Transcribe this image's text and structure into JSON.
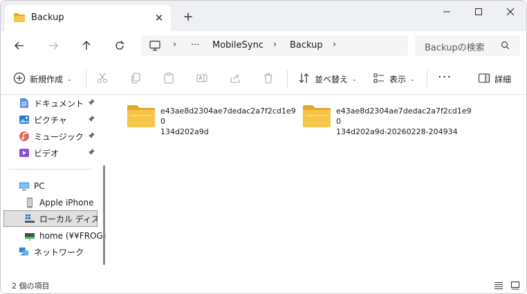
{
  "tab": {
    "title": "Backup",
    "close": "✕",
    "new_tab": "+"
  },
  "window": {
    "minimize": "—",
    "maximize": "☐",
    "close": "✕"
  },
  "address": {
    "ellipsis": "···",
    "crumbs": [
      "MobileSync",
      "Backup"
    ],
    "separator": "›"
  },
  "search": {
    "placeholder": "Backupの検索"
  },
  "toolbar": {
    "new_label": "新規作成",
    "sort_label": "並べ替え",
    "view_label": "表示",
    "more_label": "···",
    "detail_label": "詳細",
    "chevron": "⌄"
  },
  "sidebar": {
    "quick": [
      {
        "label": "ドキュメント",
        "icon": "document-icon",
        "pinned": true
      },
      {
        "label": "ピクチャ",
        "icon": "pictures-icon",
        "pinned": true
      },
      {
        "label": "ミュージック",
        "icon": "music-icon",
        "pinned": true
      },
      {
        "label": "ビデオ",
        "icon": "video-icon",
        "pinned": true
      }
    ],
    "tree": [
      {
        "label": "PC",
        "icon": "pc-icon"
      },
      {
        "label": "Apple iPhone",
        "icon": "phone-icon"
      },
      {
        "label": "ローカル ディスク (C",
        "icon": "drive-icon",
        "selected": true
      },
      {
        "label": "home (¥¥FROG)",
        "icon": "network-drive-icon"
      },
      {
        "label": "ネットワーク",
        "icon": "network-icon"
      }
    ],
    "pin_glyph": "📌"
  },
  "files": [
    {
      "name_line1": "e43ae8d2304ae7dedac2a7f2cd1e90",
      "name_line2": "134d202a9d"
    },
    {
      "name_line1": "e43ae8d2304ae7dedac2a7f2cd1e90",
      "name_line2": "134d202a9d-20260228-204934"
    }
  ],
  "status": {
    "item_count": "2 個の項目"
  },
  "colors": {
    "folder": "#f7c44a",
    "folder_dark": "#e3a92c",
    "accent": "#0067c0"
  }
}
